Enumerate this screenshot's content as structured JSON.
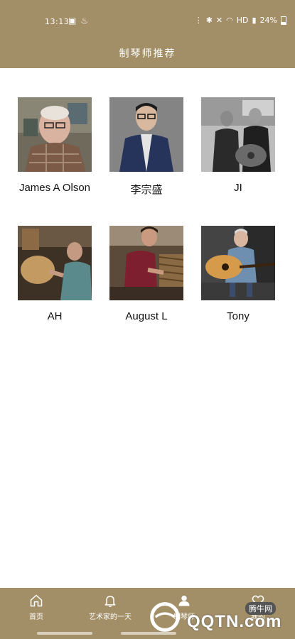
{
  "status_bar": {
    "time": "13:13",
    "battery": "24%",
    "network": "HD"
  },
  "header": {
    "title": "制琴师推荐"
  },
  "luthiers": [
    {
      "name": "James A Olson"
    },
    {
      "name": "李宗盛"
    },
    {
      "name": "JI"
    },
    {
      "name": "AH"
    },
    {
      "name": "August L"
    },
    {
      "name": "Tony"
    }
  ],
  "tabs": [
    {
      "label": "首页",
      "icon": "home-icon"
    },
    {
      "label": "艺术家的一天",
      "icon": "bell-icon"
    },
    {
      "label": "制琴师",
      "icon": "person-icon"
    },
    {
      "label": "我的",
      "icon": "heart-icon"
    }
  ],
  "watermark": {
    "text": "QQTN.com",
    "badge": "腾牛网"
  },
  "colors": {
    "brand": "#a38f67",
    "background": "#ffffff",
    "text": "#111111"
  }
}
